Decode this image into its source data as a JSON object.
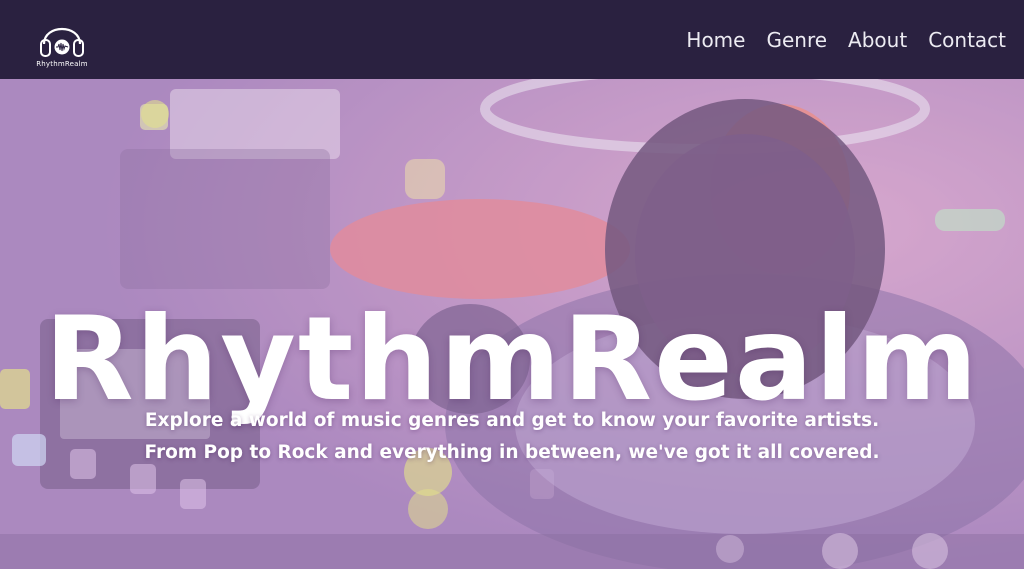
{
  "brand": {
    "name": "RhythmRealm",
    "icon": "headphones-icon"
  },
  "nav": [
    {
      "label": "Home"
    },
    {
      "label": "Genre"
    },
    {
      "label": "About"
    },
    {
      "label": "Contact"
    }
  ],
  "hero": {
    "title": "RhythmRealm",
    "subtitle_line1": "Explore a world of music genres and get to know your favorite artists.",
    "subtitle_line2": "From Pop to Rock and everything in between, we've got it all covered."
  },
  "colors": {
    "header_bg": "#2a2140",
    "nav_text": "#ecebf2",
    "hero_text": "#ffffff",
    "headphone_accent": "#f47a6b"
  }
}
